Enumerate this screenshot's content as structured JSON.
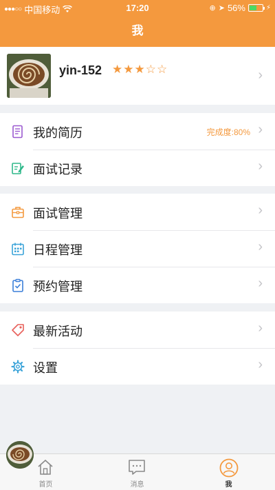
{
  "status_bar": {
    "carrier": "中国移动",
    "time": "17:20",
    "battery": "56%",
    "battery_level": 0.56
  },
  "nav": {
    "title": "我"
  },
  "profile": {
    "username": "yin-152",
    "rating": 3,
    "rating_max": 5,
    "stars_text": "★★★☆☆"
  },
  "sections": {
    "resume": {
      "label": "我的简历",
      "extra": "完成度:80%",
      "icon": "resume-icon"
    },
    "interview_records": {
      "label": "面试记录",
      "icon": "edit-note-icon"
    },
    "interview_manage": {
      "label": "面试管理",
      "icon": "briefcase-icon"
    },
    "schedule_manage": {
      "label": "日程管理",
      "icon": "calendar-icon"
    },
    "booking_manage": {
      "label": "预约管理",
      "icon": "clipboard-icon"
    },
    "latest_activity": {
      "label": "最新活动",
      "icon": "tag-icon"
    },
    "settings": {
      "label": "设置",
      "icon": "gear-icon"
    }
  },
  "tabs": [
    {
      "label": "首页",
      "icon": "home-icon",
      "active": false
    },
    {
      "label": "消息",
      "icon": "message-icon",
      "active": false
    },
    {
      "label": "我",
      "icon": "profile-icon",
      "active": true
    }
  ],
  "colors": {
    "accent": "#f4993e",
    "background": "#eff1f4",
    "text": "#222222"
  }
}
